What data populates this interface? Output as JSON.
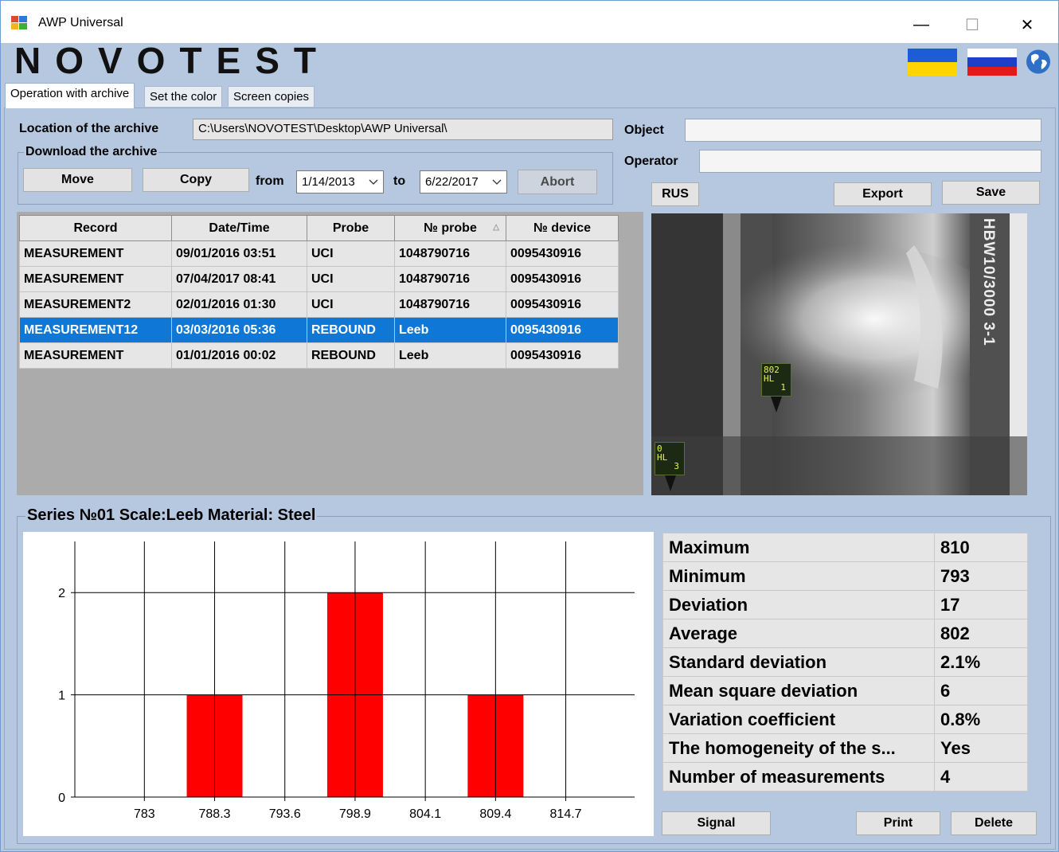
{
  "window": {
    "title": "AWP Universal",
    "minimize_glyph": "—",
    "maximize_glyph": "☐",
    "close_glyph": "✕"
  },
  "logo": "NOVOTEST",
  "icons": {
    "app": "app-window-icon",
    "flag_ukraine": "flag-ukraine-icon",
    "flag_russia": "flag-russia-icon",
    "globe": "globe-icon",
    "dropdown": "chevron-down-icon",
    "sort": "sort-ascending-icon"
  },
  "tabs": [
    {
      "label": "Operation with archive",
      "active": true
    },
    {
      "label": "Set the color",
      "active": false
    },
    {
      "label": "Screen copies",
      "active": false
    }
  ],
  "archive": {
    "location_label": "Location of the archive",
    "location_value": "C:\\Users\\NOVOTEST\\Desktop\\AWP Universal\\",
    "download_label": "Download the archive",
    "move_label": "Move",
    "copy_label": "Copy",
    "from_label": "from",
    "from_value": "1/14/2013",
    "to_label": "to",
    "to_value": "6/22/2017",
    "abort_label": "Abort"
  },
  "object": {
    "label": "Object",
    "value": ""
  },
  "operator": {
    "label": "Operator",
    "value": ""
  },
  "actions": {
    "rus_label": "RUS",
    "export_label": "Export",
    "save_label": "Save",
    "signal_label": "Signal",
    "print_label": "Print",
    "delete_label": "Delete"
  },
  "table": {
    "columns": [
      "Record",
      "Date/Time",
      "Probe",
      "№ probe",
      "№ device"
    ],
    "rows": [
      {
        "record": "MEASUREMENT",
        "datetime": "09/01/2016 03:51",
        "probe": "UCI",
        "probe_no": "1048790716",
        "device_no": "0095430916",
        "selected": false
      },
      {
        "record": "MEASUREMENT",
        "datetime": "07/04/2017 08:41",
        "probe": "UCI",
        "probe_no": "1048790716",
        "device_no": "0095430916",
        "selected": false
      },
      {
        "record": "MEASUREMENT2",
        "datetime": "02/01/2016 01:30",
        "probe": "UCI",
        "probe_no": "1048790716",
        "device_no": "0095430916",
        "selected": false
      },
      {
        "record": "MEASUREMENT12",
        "datetime": "03/03/2016 05:36",
        "probe": "REBOUND",
        "probe_no": "Leeb",
        "device_no": "0095430916",
        "selected": true
      },
      {
        "record": "MEASUREMENT",
        "datetime": "01/01/2016 00:02",
        "probe": "REBOUND",
        "probe_no": "Leeb",
        "device_no": "0095430916",
        "selected": false
      }
    ]
  },
  "photo": {
    "side_text": "HBW10/3000 3-1",
    "marker1": {
      "value": "802",
      "scale": "HL",
      "index": "1"
    },
    "marker2": {
      "value": "0",
      "scale": "HL",
      "index": "3"
    }
  },
  "series_title": "Series №01 Scale:Leeb Material: Steel",
  "stats": [
    {
      "label": "Maximum",
      "value": "810"
    },
    {
      "label": "Minimum",
      "value": "793"
    },
    {
      "label": "Deviation",
      "value": "17"
    },
    {
      "label": "Average",
      "value": "802"
    },
    {
      "label": "Standard deviation",
      "value": "2.1%"
    },
    {
      "label": "Mean square deviation",
      "value": "6"
    },
    {
      "label": "Variation coefficient",
      "value": "0.8%"
    },
    {
      "label": "The homogeneity of the s...",
      "value": "Yes"
    },
    {
      "label": "Number of measurements",
      "value": "4"
    }
  ],
  "chart_data": {
    "type": "bar",
    "categories": [
      "783",
      "788.3",
      "793.6",
      "798.9",
      "804.1",
      "809.4",
      "814.7"
    ],
    "values": [
      0,
      1,
      0,
      2,
      0,
      1,
      0
    ],
    "ylim": [
      0,
      2.5
    ],
    "yticks": [
      0,
      1,
      2
    ],
    "grid": true,
    "bar_color": "#ff0000"
  },
  "colors": {
    "selected_row": "#0f78d7",
    "panel_bg": "#b6c8df",
    "bar": "#ff0000"
  }
}
